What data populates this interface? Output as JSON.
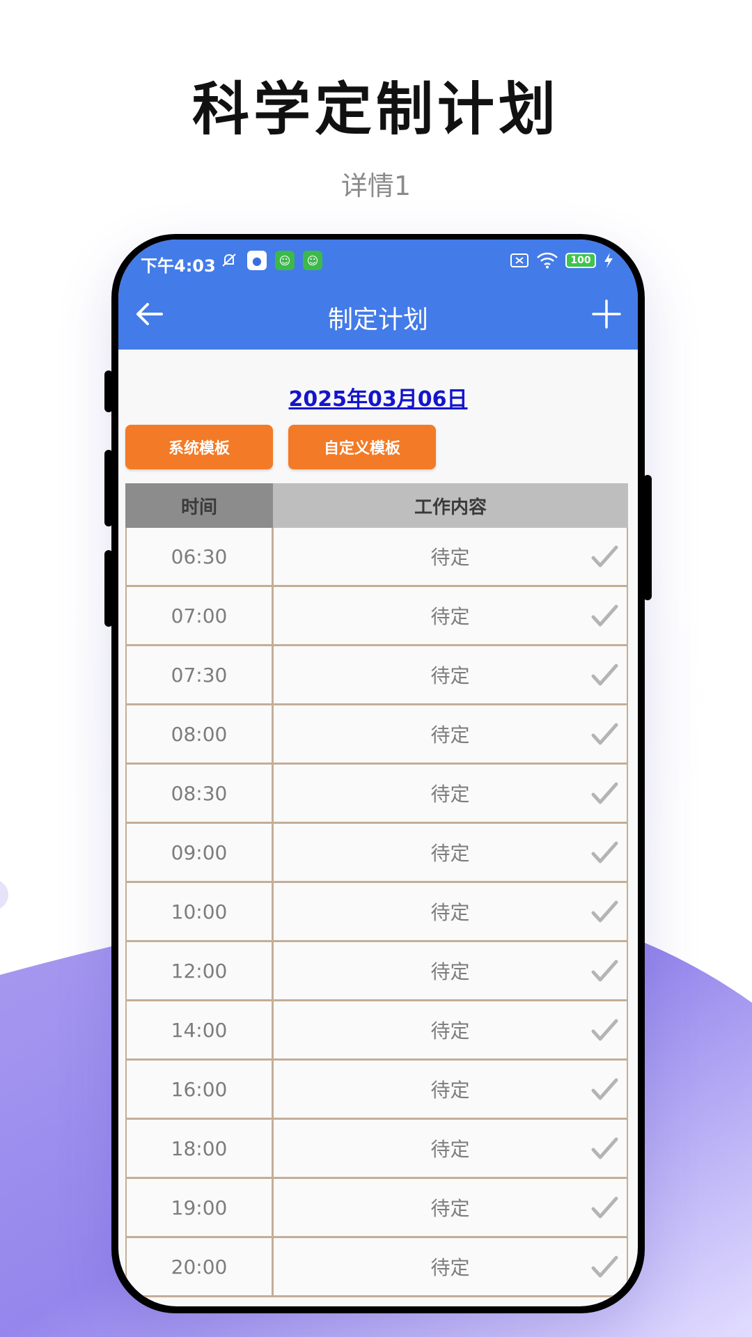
{
  "promo": {
    "title": "科学定制计划",
    "subtitle": "详情1"
  },
  "status_bar": {
    "time": "下午4:03",
    "battery": "100",
    "icons_left": [
      "bell-off-icon",
      "baidu-paw-icon",
      "app-robot-icon",
      "app-robot-icon"
    ],
    "icons_right": [
      "sim-x-icon",
      "wifi-icon",
      "battery-icon",
      "charging-icon"
    ]
  },
  "app_bar": {
    "title": "制定计划",
    "back_icon": "arrow-left-icon",
    "add_icon": "plus-icon"
  },
  "date": "2025年03月06日",
  "buttons": {
    "system_template": "系统模板",
    "custom_template": "自定义模板"
  },
  "table": {
    "col_time": "时间",
    "col_content": "工作内容",
    "rows": [
      {
        "time": "06:30",
        "content": "待定"
      },
      {
        "time": "07:00",
        "content": "待定"
      },
      {
        "time": "07:30",
        "content": "待定"
      },
      {
        "time": "08:00",
        "content": "待定"
      },
      {
        "time": "08:30",
        "content": "待定"
      },
      {
        "time": "09:00",
        "content": "待定"
      },
      {
        "time": "10:00",
        "content": "待定"
      },
      {
        "time": "12:00",
        "content": "待定"
      },
      {
        "time": "14:00",
        "content": "待定"
      },
      {
        "time": "16:00",
        "content": "待定"
      },
      {
        "time": "18:00",
        "content": "待定"
      },
      {
        "time": "19:00",
        "content": "待定"
      },
      {
        "time": "20:00",
        "content": "待定"
      }
    ]
  },
  "colors": {
    "app_bar": "#437be8",
    "button": "#f37a26",
    "date_link": "#1414cc",
    "row_border": "#c4ad97",
    "check": "#b4b4b4",
    "bg_accent": "#8f7fec"
  }
}
